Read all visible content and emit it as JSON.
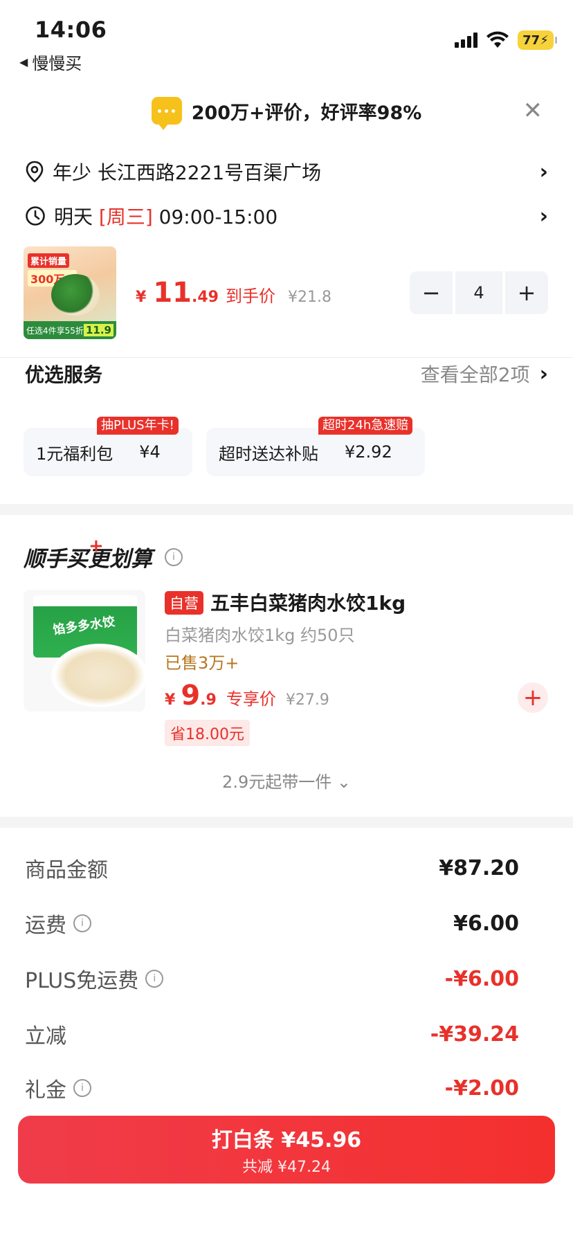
{
  "status_bar": {
    "time": "14:06",
    "back_label": "慢慢买",
    "battery": "77"
  },
  "banner": {
    "text": "200万+评价，好评率98%"
  },
  "delivery": {
    "address": "年少  长江西路2221号百渠广场",
    "time_prefix": "明天 ",
    "time_day": "[周三]",
    "time_range": " 09:00-15:00"
  },
  "product": {
    "img_tag": "累计销量",
    "img_count": "300万+",
    "img_bottom": "任选4件享55折",
    "img_price": "11.9",
    "price_yen": "¥",
    "price_int": "11",
    "price_dec": ".49",
    "price_label": "到手价",
    "old_price": "¥21.8",
    "quantity": "4",
    "minus": "−",
    "plus": "+"
  },
  "services": {
    "title": "优选服务",
    "see_all": "查看全部2项",
    "items": [
      {
        "name": "1元福利包",
        "price": "¥4",
        "badge": "抽PLUS年卡!"
      },
      {
        "name": "超时送达补贴",
        "price": "¥2.92",
        "badge": "超时24h急速赔"
      }
    ]
  },
  "addon": {
    "title": "顺手买更划算",
    "title_plus": "+",
    "item": {
      "tag": "自营",
      "name": "五丰白菜猪肉水饺1kg",
      "sub": "白菜猪肉水饺1kg 约50只",
      "sold": "已售3万+",
      "price_yen": "¥",
      "price_int": "9",
      "price_dec": ".9",
      "price_label": "专享价",
      "old_price": "¥27.9",
      "save": "省18.00元",
      "img_text": "馅多多水饺"
    },
    "more": "2.9元起带一件 ⌄"
  },
  "summary": {
    "rows": [
      {
        "label": "商品金额",
        "value": "¥87.20",
        "info": false,
        "red": false
      },
      {
        "label": "运费",
        "value": "¥6.00",
        "info": true,
        "red": false
      },
      {
        "label": "PLUS免运费",
        "value": "-¥6.00",
        "info": true,
        "red": true
      },
      {
        "label": "立减",
        "value": "-¥39.24",
        "info": false,
        "red": true
      },
      {
        "label": "礼金",
        "value": "-¥2.00",
        "info": true,
        "red": true
      }
    ]
  },
  "pay": {
    "main": "打白条 ¥45.96",
    "sub": "共减 ¥47.24"
  },
  "colors": {
    "accent": "#e8312a",
    "gold": "#b5751f"
  }
}
